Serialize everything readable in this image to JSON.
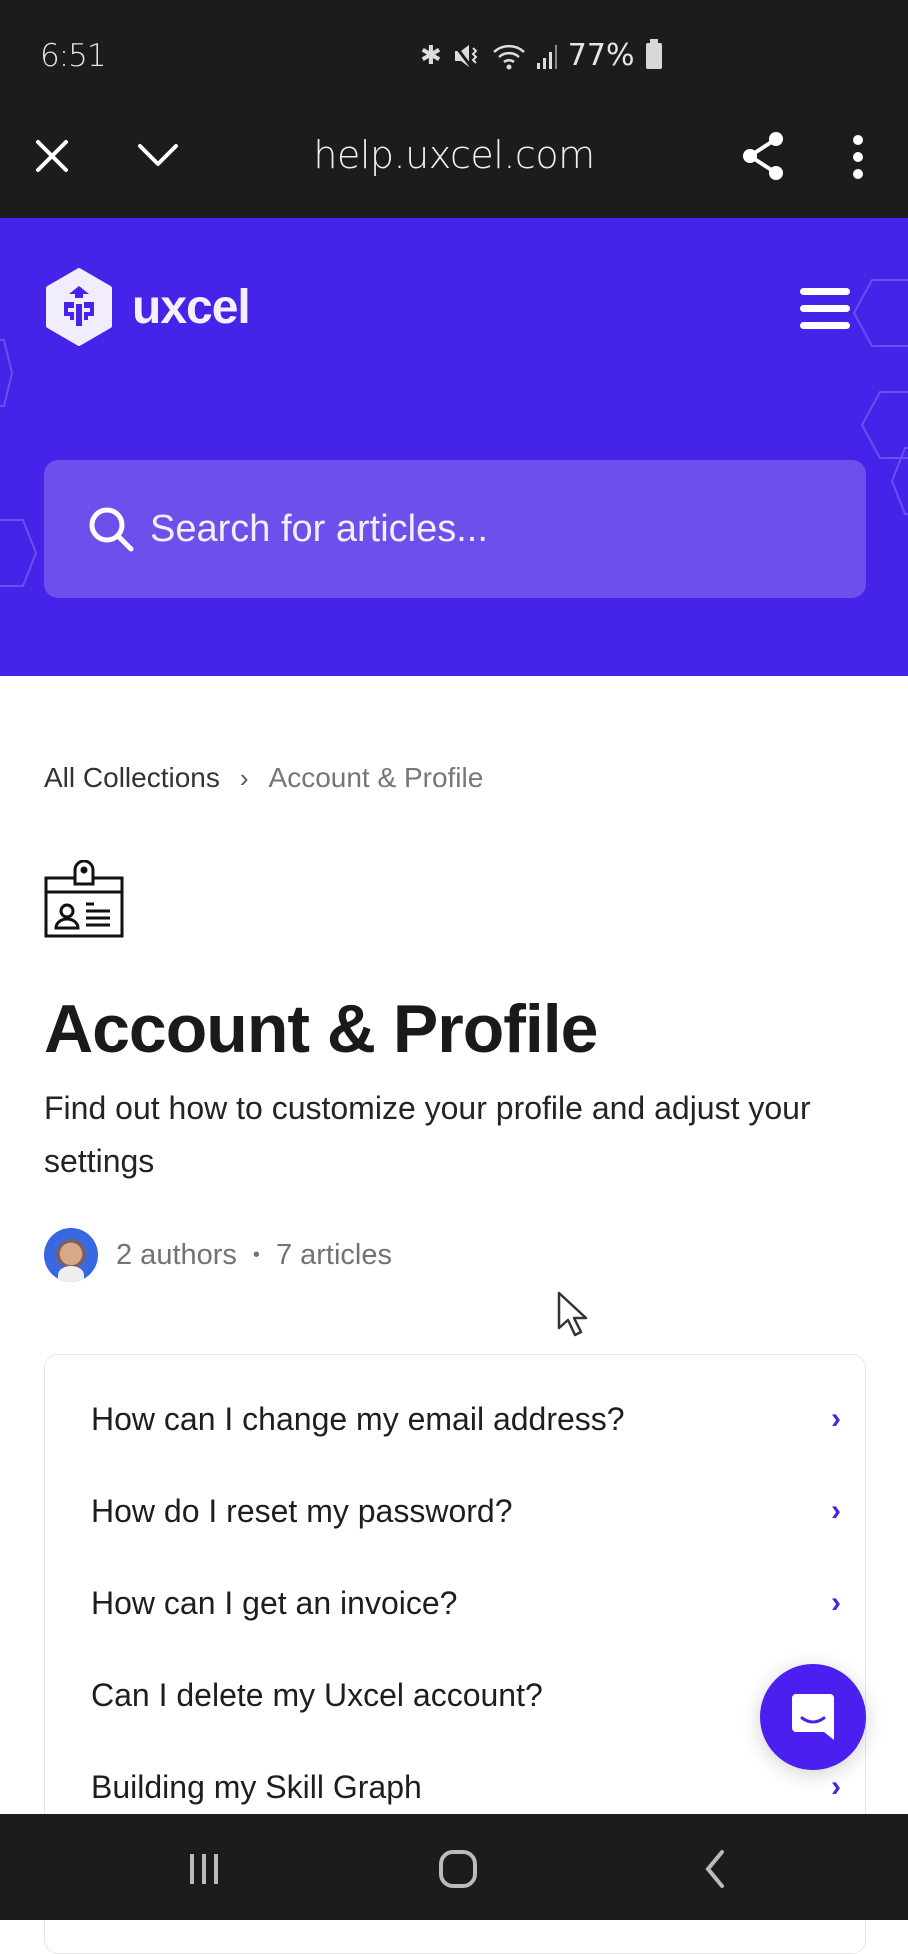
{
  "status_bar": {
    "time": "6:51",
    "icons": [
      "bluetooth-icon",
      "vibrate-mute-icon",
      "wifi-icon",
      "signal-icon"
    ],
    "battery": "77%"
  },
  "browser": {
    "url": "help.uxcel.com",
    "close_label": "close",
    "minimize_label": "minimize",
    "share_label": "share",
    "more_label": "more"
  },
  "header": {
    "brand": "uxcel",
    "menu_label": "menu",
    "search_placeholder": "Search for articles...",
    "colors": {
      "hero_bg": "#4623e9",
      "search_bg": "#6d4fec"
    }
  },
  "breadcrumb": {
    "items": [
      {
        "label": "All Collections"
      },
      {
        "label": "Account & Profile"
      }
    ],
    "separator": "›"
  },
  "collection": {
    "icon": "id-badge-icon",
    "title": "Account & Profile",
    "description": "Find out how to customize your profile and adjust your settings",
    "authors": "2 authors",
    "separator": "•",
    "articles_count": "7 articles"
  },
  "articles": [
    {
      "title": "How can I change my email address?"
    },
    {
      "title": "How do I reset my password?"
    },
    {
      "title": "How can I get an invoice?"
    },
    {
      "title": "Can I delete my Uxcel account?"
    },
    {
      "title": "Building my Skill Graph"
    }
  ],
  "chat": {
    "label": "open chat",
    "color": "#4a1ff0"
  },
  "nav_bar": {
    "recents_label": "recent apps",
    "home_label": "home",
    "back_label": "back"
  }
}
